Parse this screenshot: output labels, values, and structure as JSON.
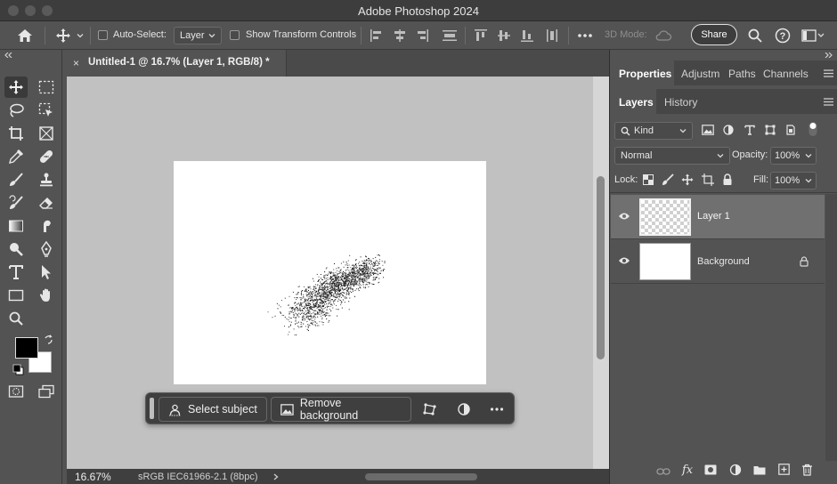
{
  "app": {
    "title": "Adobe Photoshop 2024"
  },
  "options_bar": {
    "auto_select_label": "Auto-Select:",
    "auto_select_value": "Layer",
    "show_transform_label": "Show Transform Controls",
    "mode_3d_label": "3D Mode:",
    "share_label": "Share"
  },
  "document": {
    "tab_title": "Untitled-1 @ 16.7% (Layer 1, RGB/8) *",
    "zoom": "16.67%",
    "color_profile": "sRGB IEC61966-2.1 (8bpc)"
  },
  "taskbar": {
    "select_subject_label": "Select subject",
    "remove_background_label": "Remove background"
  },
  "panels": {
    "top_tabs": [
      "Properties",
      "Adjustm",
      "Paths",
      "Channels"
    ],
    "layer_tabs": [
      "Layers",
      "History"
    ],
    "filter_kind": "Kind",
    "blend_mode": "Normal",
    "opacity_label": "Opacity:",
    "opacity_value": "100%",
    "lock_label": "Lock:",
    "fill_label": "Fill:",
    "fill_value": "100%",
    "layers": [
      {
        "name": "Layer 1",
        "selected": true,
        "visible": true
      },
      {
        "name": "Background",
        "selected": false,
        "visible": true,
        "locked": true
      }
    ]
  },
  "colors": {
    "foreground": "#000000",
    "background": "#ffffff",
    "canvas_bg": "#c1c1c1",
    "panel_bg": "#535353"
  }
}
